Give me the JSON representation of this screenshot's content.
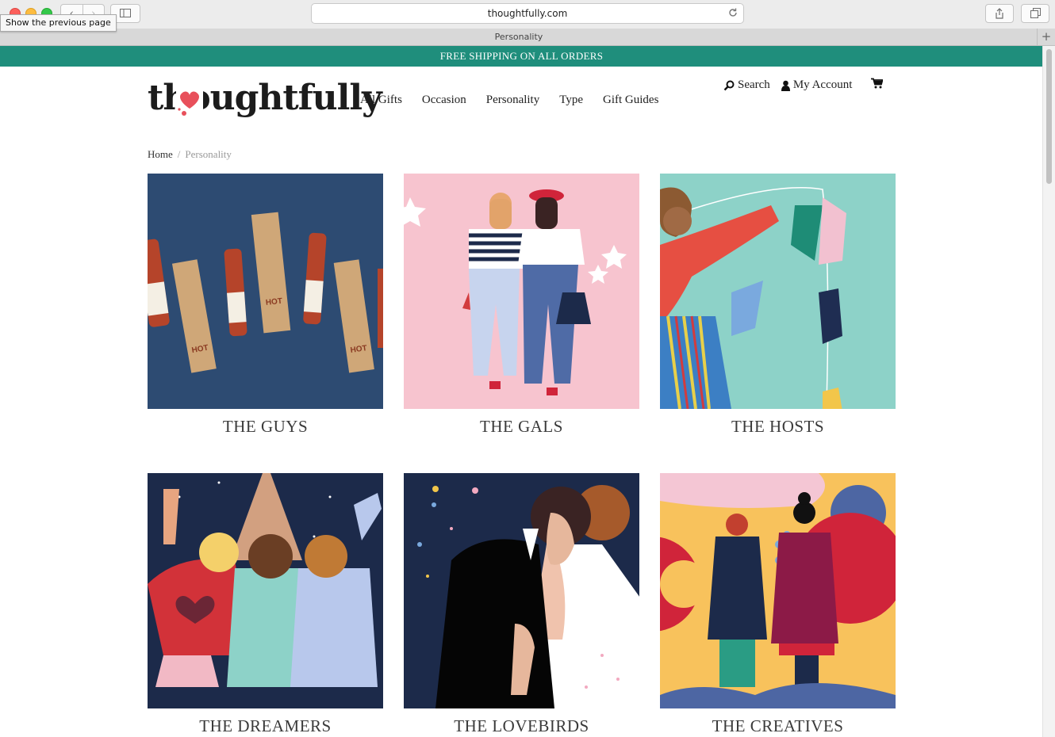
{
  "browser": {
    "tooltip": "Show the previous page",
    "back_icon": "chevron-left-icon",
    "forward_icon": "chevron-right-icon",
    "url": "thoughtfully.com",
    "tab_title": "Personality",
    "new_tab": "+"
  },
  "banner": {
    "text": "FREE SHIPPING ON ALL ORDERS",
    "color": "#1f8e7c"
  },
  "header": {
    "logo": "thoughtfully",
    "nav": [
      "All Gifts",
      "Occasion",
      "Personality",
      "Type",
      "Gift Guides"
    ],
    "search_label": "Search",
    "account_label": "My Account"
  },
  "breadcrumb": {
    "home": "Home",
    "separator": "/",
    "current": "Personality"
  },
  "categories": [
    {
      "label": "THE GUYS"
    },
    {
      "label": "THE GALS"
    },
    {
      "label": "THE HOSTS"
    },
    {
      "label": "THE DREAMERS"
    },
    {
      "label": "THE LOVEBIRDS"
    },
    {
      "label": "THE CREATIVES"
    }
  ]
}
